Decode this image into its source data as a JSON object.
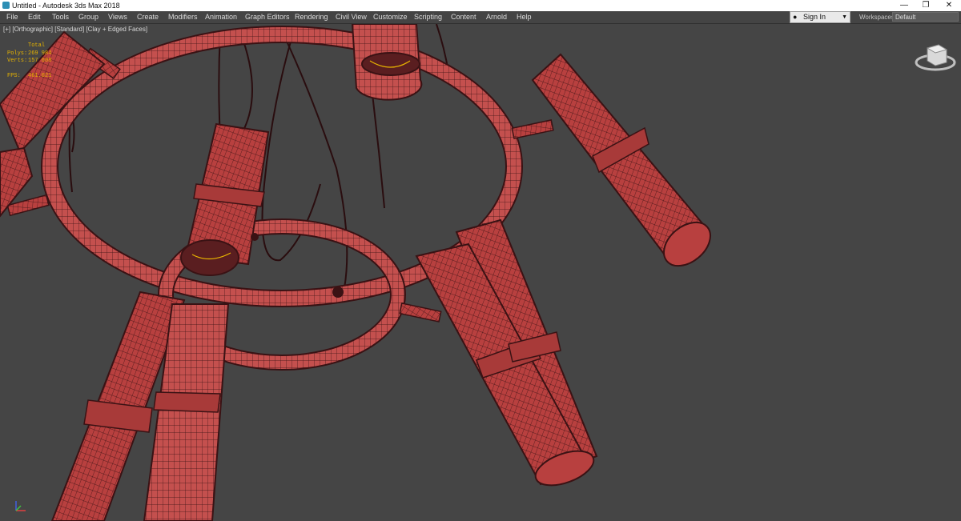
{
  "window": {
    "title": "Untitled - Autodesk 3ds Max 2018",
    "minimize": "—",
    "restore": "❐",
    "close": "✕"
  },
  "menu": [
    "File",
    "Edit",
    "Tools",
    "Group",
    "Views",
    "Create",
    "Modifiers",
    "Animation",
    "Graph Editors",
    "Rendering",
    "Civil View",
    "Customize",
    "Scripting",
    "Content",
    "Arnold",
    "Help"
  ],
  "signin": {
    "label": "Sign In"
  },
  "workspaces": {
    "label": "Workspaces:",
    "value": "Default"
  },
  "viewport": {
    "label": "[+] [Orthographic] [Standard] [Clay + Edged Faces]",
    "stats": {
      "header": "Total",
      "polys_label": "Polys:",
      "polys_value": "269 984",
      "verts_label": "Verts:",
      "verts_value": "157 608",
      "fps_label": "FPS:",
      "fps_value": "461.021"
    }
  },
  "colors": {
    "model_fill": "#c4504e",
    "wire": "#3a1214",
    "viewport_bg": "#454545",
    "stats_text": "#e8b400"
  },
  "icons": {
    "viewcube": "viewcube-icon",
    "axis": "axis-tripod-icon",
    "app": "app-icon",
    "user": "user-icon"
  }
}
